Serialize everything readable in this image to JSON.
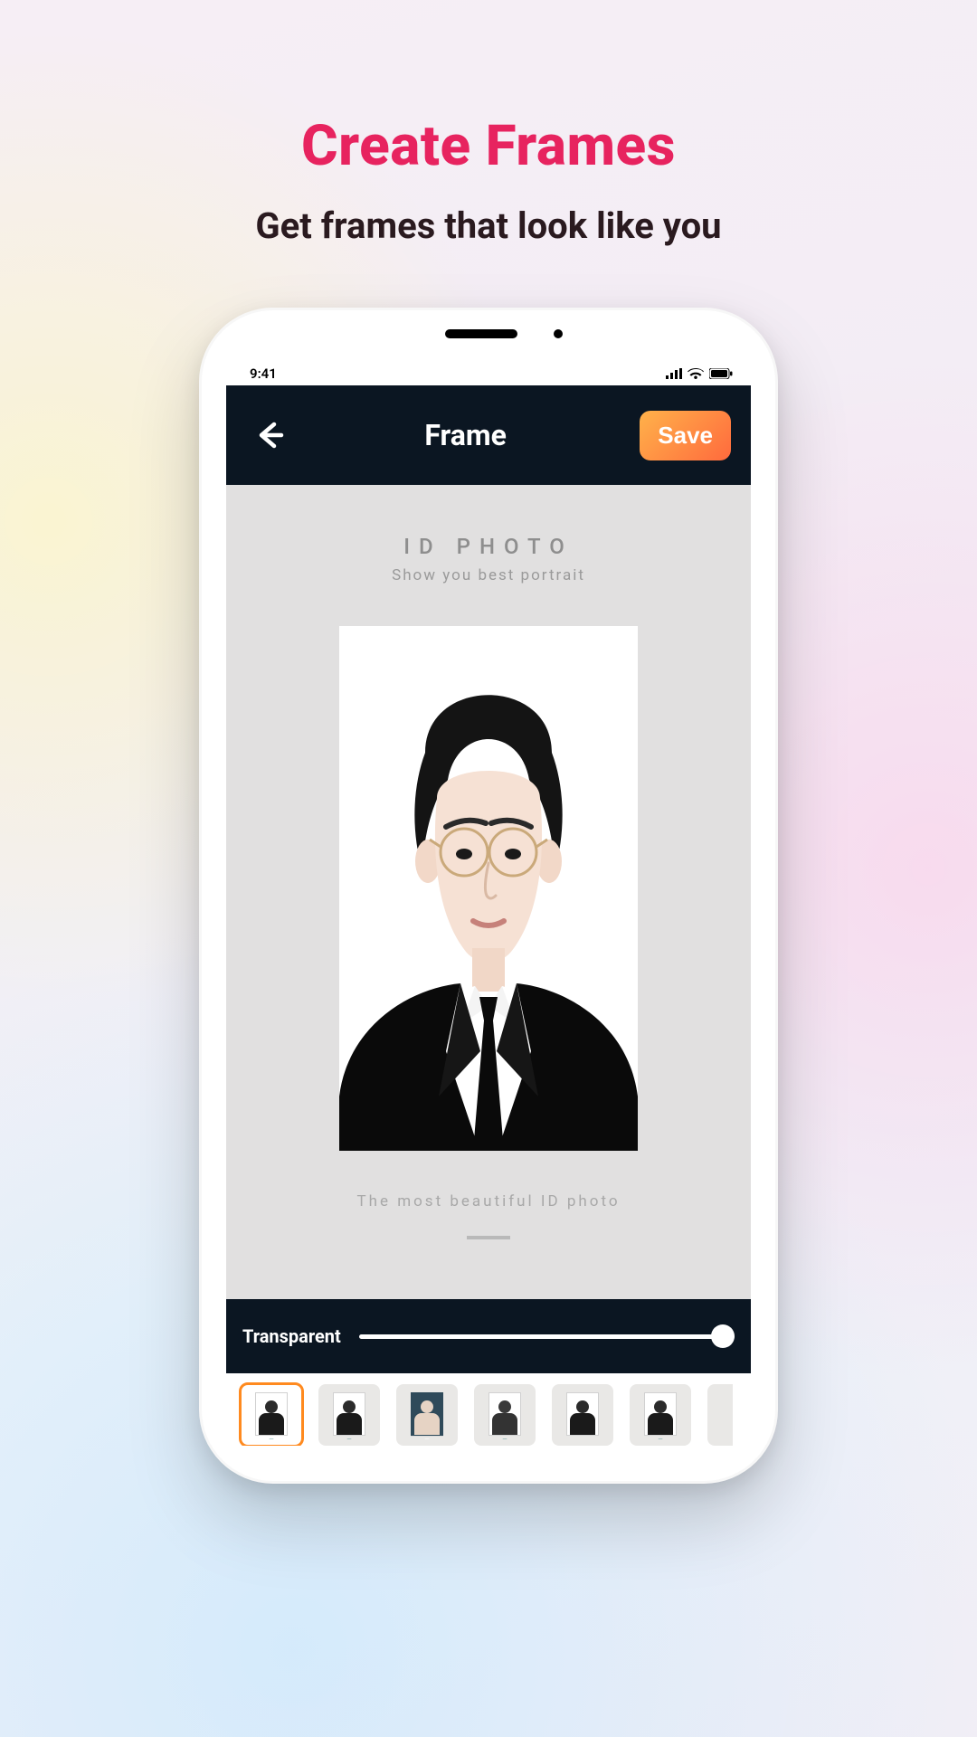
{
  "hero": {
    "title": "Create Frames",
    "subtitle": "Get frames that look like you"
  },
  "status_bar": {
    "time": "9:41"
  },
  "app": {
    "header_title": "Frame",
    "save_label": "Save"
  },
  "canvas": {
    "top_label": "ID PHOTO",
    "top_sub": "Show you best portrait",
    "bottom_caption": "The most beautiful ID photo"
  },
  "slider": {
    "label": "Transparent",
    "value_pct": 100
  },
  "thumbs": [
    {
      "selected": true,
      "variant": "male",
      "dark": false
    },
    {
      "selected": false,
      "variant": "male",
      "dark": false
    },
    {
      "selected": false,
      "variant": "male",
      "dark": true
    },
    {
      "selected": false,
      "variant": "female",
      "dark": false
    },
    {
      "selected": false,
      "variant": "male",
      "dark": false
    },
    {
      "selected": false,
      "variant": "male",
      "dark": false
    }
  ]
}
